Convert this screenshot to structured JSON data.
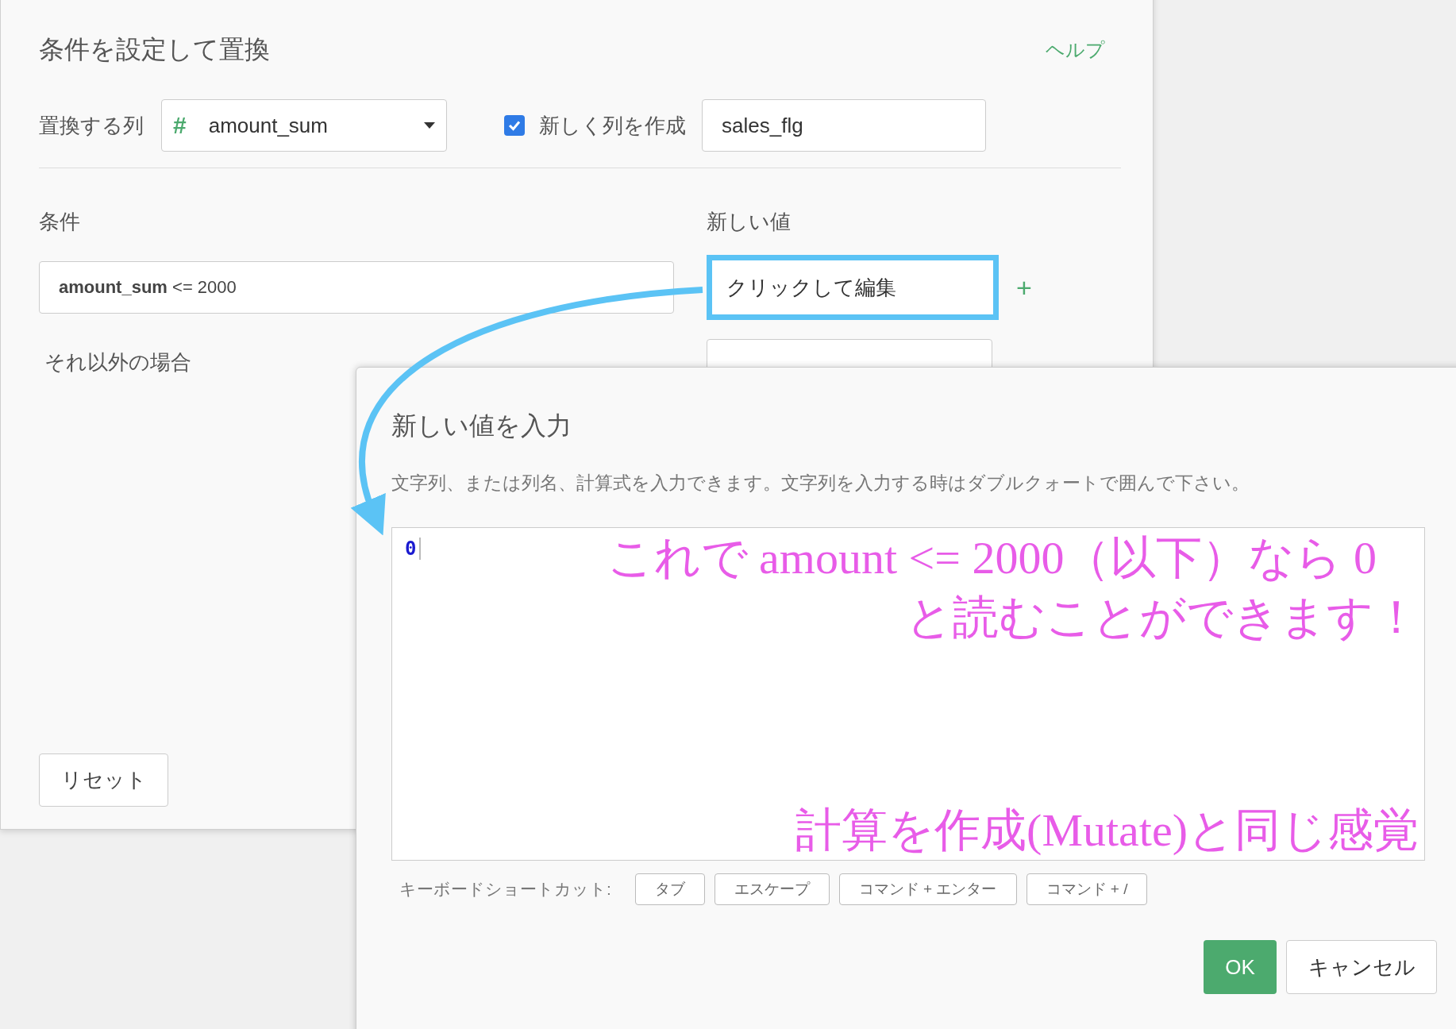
{
  "replace_dialog": {
    "title": "条件を設定して置換",
    "help_link": "ヘルプ",
    "column_label": "置換する列",
    "column_select": {
      "type_icon": "#",
      "value": "amount_sum"
    },
    "new_column": {
      "checked": true,
      "label": "新しく列を作成",
      "value": "sales_flg"
    },
    "condition_header": "条件",
    "new_value_header": "新しい値",
    "condition_field": "**amount_sum** <= 2000",
    "new_value_field": {
      "value": "クリックして編集",
      "highlighted": true
    },
    "add_button": "+",
    "otherwise_label": "それ以外の場合",
    "reset_button": "リセット"
  },
  "input_dialog": {
    "title": "新しい値を入力",
    "description": "文字列、または列名、計算式を入力できます。文字列を入力する時はダブルクォートで囲んで下さい。",
    "editor_value": "0",
    "shortcuts_label": "キーボードショートカット:",
    "shortcuts": [
      "タブ",
      "エスケープ",
      "コマンド + エンター",
      "コマンド + /"
    ],
    "ok_button": "OK",
    "cancel_button": "キャンセル"
  },
  "annotations": [
    {
      "text": "これで amount <= 2000（以下）なら 0"
    },
    {
      "text": "と読むことができます！"
    },
    {
      "text": "計算を作成(Mutate)と同じ感覚"
    }
  ]
}
